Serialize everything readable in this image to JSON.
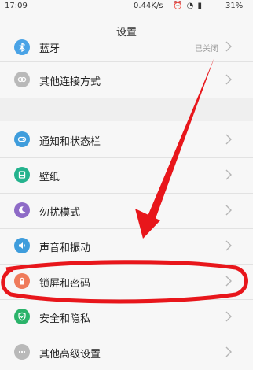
{
  "status_bar": {
    "time": "17:09",
    "net_speed": "0.44K/s",
    "battery": "31%"
  },
  "header": {
    "title": "设置"
  },
  "rows": [
    {
      "label": "蓝牙",
      "value": "已关闭",
      "icon": "bluetooth-icon",
      "color": "#4aa3e6"
    },
    {
      "label": "其他连接方式",
      "icon": "link-icon",
      "color": "#b9b9b9"
    },
    {
      "label": "通知和状态栏",
      "icon": "notification-icon",
      "color": "#3f9ddc"
    },
    {
      "label": "壁纸",
      "icon": "wallpaper-icon",
      "color": "#25b38e"
    },
    {
      "label": "勿扰模式",
      "icon": "moon-icon",
      "color": "#8e6bc7"
    },
    {
      "label": "声音和振动",
      "icon": "speaker-icon",
      "color": "#3f9ddc"
    },
    {
      "label": "锁屏和密码",
      "icon": "lock-icon",
      "color": "#ef7b5b"
    },
    {
      "label": "安全和隐私",
      "icon": "shield-icon",
      "color": "#2bb36a"
    },
    {
      "label": "其他高级设置",
      "icon": "more-icon",
      "color": "#b9b9b9"
    }
  ],
  "annotations": {
    "arrow_color": "#e8161b",
    "circle_color": "#e8161b"
  }
}
